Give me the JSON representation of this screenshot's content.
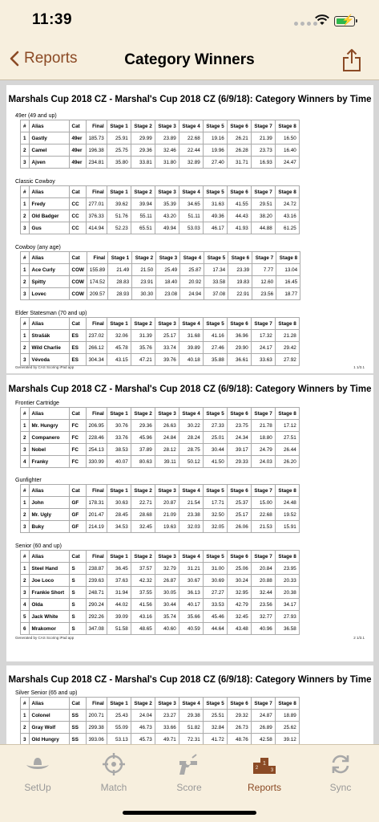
{
  "status": {
    "time": "11:39"
  },
  "nav": {
    "back_label": "Reports",
    "title": "Category Winners"
  },
  "headers": [
    "#",
    "Alias",
    "Cat",
    "Final",
    "Stage 1",
    "Stage 2",
    "Stage 3",
    "Stage 4",
    "Stage 5",
    "Stage 6",
    "Stage 7",
    "Stage 8"
  ],
  "pages": [
    {
      "title": "Marshals Cup 2018 CZ - Marshal's Cup 2018 CZ (6/9/18): Category Winners by Time",
      "footer_left": "Generated by CAS Scoring iPad app",
      "footer_right": "1 1/3.1",
      "sections": [
        {
          "name": "49er (49 and up)",
          "rows": [
            [
              "1",
              "Gastly",
              "49er",
              "185.73",
              "25.91",
              "29.99",
              "23.89",
              "22.68",
              "19.16",
              "26.21",
              "21.39",
              "16.50"
            ],
            [
              "2",
              "Camel",
              "49er",
              "196.38",
              "25.75",
              "29.36",
              "32.46",
              "22.44",
              "19.96",
              "26.28",
              "23.73",
              "16.40"
            ],
            [
              "3",
              "Ajven",
              "49er",
              "234.81",
              "35.80",
              "33.81",
              "31.80",
              "32.89",
              "27.40",
              "31.71",
              "16.93",
              "24.47"
            ]
          ]
        },
        {
          "name": "Classic Cowboy",
          "rows": [
            [
              "1",
              "Fredy",
              "CC",
              "277.01",
              "39.62",
              "39.94",
              "35.39",
              "34.65",
              "31.63",
              "41.55",
              "29.51",
              "24.72"
            ],
            [
              "2",
              "Old Badger",
              "CC",
              "376.33",
              "51.76",
              "55.11",
              "43.20",
              "51.11",
              "49.36",
              "44.43",
              "38.20",
              "43.16"
            ],
            [
              "3",
              "Gus",
              "CC",
              "414.94",
              "52.23",
              "65.51",
              "49.94",
              "53.03",
              "46.17",
              "41.93",
              "44.88",
              "61.25"
            ]
          ]
        },
        {
          "name": "Cowboy (any age)",
          "rows": [
            [
              "1",
              "Ace Curly",
              "COW",
              "155.89",
              "21.49",
              "21.50",
              "25.49",
              "25.87",
              "17.34",
              "23.39",
              "7.77",
              "13.04"
            ],
            [
              "2",
              "Spitty",
              "COW",
              "174.52",
              "28.83",
              "23.91",
              "18.40",
              "20.92",
              "33.58",
              "19.83",
              "12.60",
              "16.45"
            ],
            [
              "3",
              "Lovec",
              "COW",
              "209.57",
              "28.93",
              "30.30",
              "23.08",
              "24.94",
              "37.08",
              "22.91",
              "23.56",
              "18.77"
            ]
          ]
        },
        {
          "name": "Elder Statesman (70 and up)",
          "rows": [
            [
              "1",
              "Strašák",
              "ES",
              "237.02",
              "32.06",
              "31.39",
              "25.17",
              "31.68",
              "41.16",
              "36.96",
              "17.32",
              "21.28"
            ],
            [
              "2",
              "Wild Charlie",
              "ES",
              "266.12",
              "45.78",
              "35.76",
              "33.74",
              "39.89",
              "27.46",
              "29.90",
              "24.17",
              "29.42"
            ],
            [
              "3",
              "Vévoda",
              "ES",
              "304.34",
              "43.15",
              "47.21",
              "39.76",
              "40.18",
              "35.88",
              "36.61",
              "33.63",
              "27.92"
            ]
          ]
        }
      ]
    },
    {
      "title": "Marshals Cup 2018 CZ - Marshal's Cup 2018 CZ (6/9/18): Category Winners by Time",
      "footer_left": "Generated by CAS Scoring iPad app",
      "footer_right": "2 1/3.1",
      "sections": [
        {
          "name": "Frontier Cartridge",
          "rows": [
            [
              "1",
              "Mr. Hungry",
              "FC",
              "206.95",
              "30.76",
              "29.36",
              "26.63",
              "30.22",
              "27.33",
              "23.75",
              "21.78",
              "17.12"
            ],
            [
              "2",
              "Companero",
              "FC",
              "228.46",
              "33.76",
              "45.96",
              "24.84",
              "28.24",
              "25.01",
              "24.34",
              "18.80",
              "27.51"
            ],
            [
              "3",
              "Nobel",
              "FC",
              "254.13",
              "38.53",
              "37.89",
              "28.12",
              "28.75",
              "30.44",
              "39.17",
              "24.79",
              "26.44"
            ],
            [
              "4",
              "Franky",
              "FC",
              "330.99",
              "40.07",
              "80.63",
              "39.11",
              "50.12",
              "41.50",
              "29.33",
              "24.03",
              "26.20"
            ]
          ]
        },
        {
          "name": "Gunfighter",
          "rows": [
            [
              "1",
              "John",
              "GF",
              "178.31",
              "30.63",
              "22.71",
              "20.87",
              "21.54",
              "17.71",
              "25.37",
              "15.00",
              "24.48"
            ],
            [
              "2",
              "Mr. Ugly",
              "GF",
              "201.47",
              "28.45",
              "28.68",
              "21.09",
              "23.38",
              "32.50",
              "25.17",
              "22.68",
              "19.52"
            ],
            [
              "3",
              "Buky",
              "GF",
              "214.19",
              "34.53",
              "32.45",
              "19.63",
              "32.03",
              "32.05",
              "26.06",
              "21.53",
              "15.91"
            ]
          ]
        },
        {
          "name": "Senior (60 and up)",
          "rows": [
            [
              "1",
              "Steel Hand",
              "S",
              "238.87",
              "36.45",
              "37.57",
              "32.79",
              "31.21",
              "31.00",
              "25.06",
              "20.84",
              "23.95"
            ],
            [
              "2",
              "Joe Loco",
              "S",
              "239.63",
              "37.63",
              "42.32",
              "26.87",
              "30.67",
              "30.69",
              "30.24",
              "20.88",
              "20.33"
            ],
            [
              "3",
              "Frankie Short",
              "S",
              "248.71",
              "31.94",
              "37.55",
              "30.05",
              "36.13",
              "27.27",
              "32.95",
              "32.44",
              "20.38"
            ],
            [
              "4",
              "Olda",
              "S",
              "290.24",
              "44.02",
              "41.56",
              "30.44",
              "40.17",
              "33.53",
              "42.79",
              "23.56",
              "34.17"
            ],
            [
              "5",
              "Jack White",
              "S",
              "292.26",
              "39.09",
              "43.16",
              "35.74",
              "35.66",
              "45.46",
              "32.45",
              "32.77",
              "27.93"
            ],
            [
              "6",
              "Mrakomor",
              "S",
              "347.08",
              "51.58",
              "48.65",
              "40.60",
              "40.59",
              "44.64",
              "43.48",
              "40.96",
              "36.58"
            ]
          ]
        }
      ]
    },
    {
      "title": "Marshals Cup 2018 CZ - Marshal's Cup 2018 CZ (6/9/18): Category Winners by Time",
      "footer_left": "",
      "footer_right": "",
      "sections": [
        {
          "name": "Silver Senior (65 and up)",
          "rows": [
            [
              "1",
              "Colonel",
              "SS",
              "200.71",
              "25.43",
              "24.04",
              "23.27",
              "29.38",
              "25.51",
              "29.32",
              "24.87",
              "18.89"
            ],
            [
              "2",
              "Gray Wolf",
              "SS",
              "299.38",
              "55.09",
              "46.73",
              "33.66",
              "51.82",
              "32.84",
              "26.73",
              "26.89",
              "25.62"
            ],
            [
              "3",
              "Old Hungry",
              "SS",
              "393.06",
              "53.13",
              "45.73",
              "49.71",
              "72.31",
              "41.72",
              "48.76",
              "42.58",
              "39.12"
            ]
          ]
        }
      ]
    }
  ],
  "tabs": [
    {
      "label": "SetUp",
      "icon": "cowboy-hat-icon",
      "active": false
    },
    {
      "label": "Match",
      "icon": "crosshair-icon",
      "active": false
    },
    {
      "label": "Score",
      "icon": "revolver-icon",
      "active": false
    },
    {
      "label": "Reports",
      "icon": "podium-icon",
      "active": true
    },
    {
      "label": "Sync",
      "icon": "sync-icon",
      "active": false
    }
  ]
}
